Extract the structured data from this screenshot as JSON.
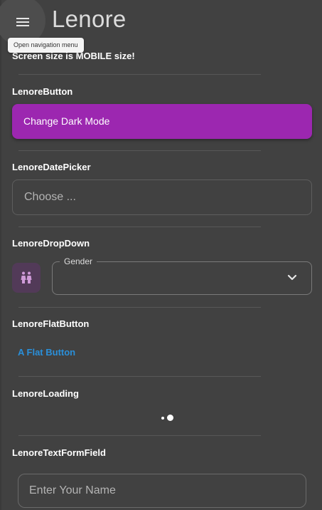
{
  "app_bar": {
    "title": "Lenore",
    "menu_icon": "menu-icon",
    "menu_tooltip": "Open navigation menu"
  },
  "screen_size_text": "Screen size is MOBILE size!",
  "sections": {
    "button": {
      "label": "LenoreButton",
      "button_text": "Change Dark Mode",
      "button_color": "#9c27b0"
    },
    "date_picker": {
      "label": "LenoreDatePicker",
      "placeholder": "Choose ..."
    },
    "dropdown": {
      "label": "LenoreDropDown",
      "field_label": "Gender",
      "selected_value": "",
      "leading_icon": "wc-people-icon",
      "trailing_icon": "chevron-down-icon"
    },
    "flat_button": {
      "label": "LenoreFlatButton",
      "button_text": "A Flat Button",
      "text_color": "#2a8fd9"
    },
    "loading": {
      "label": "LenoreLoading"
    },
    "text_form_field": {
      "label": "LenoreTextFormField",
      "placeholder": "Enter Your Name"
    }
  },
  "colors": {
    "background": "#414141",
    "accent": "#9c27b0",
    "link": "#2a8fd9"
  }
}
